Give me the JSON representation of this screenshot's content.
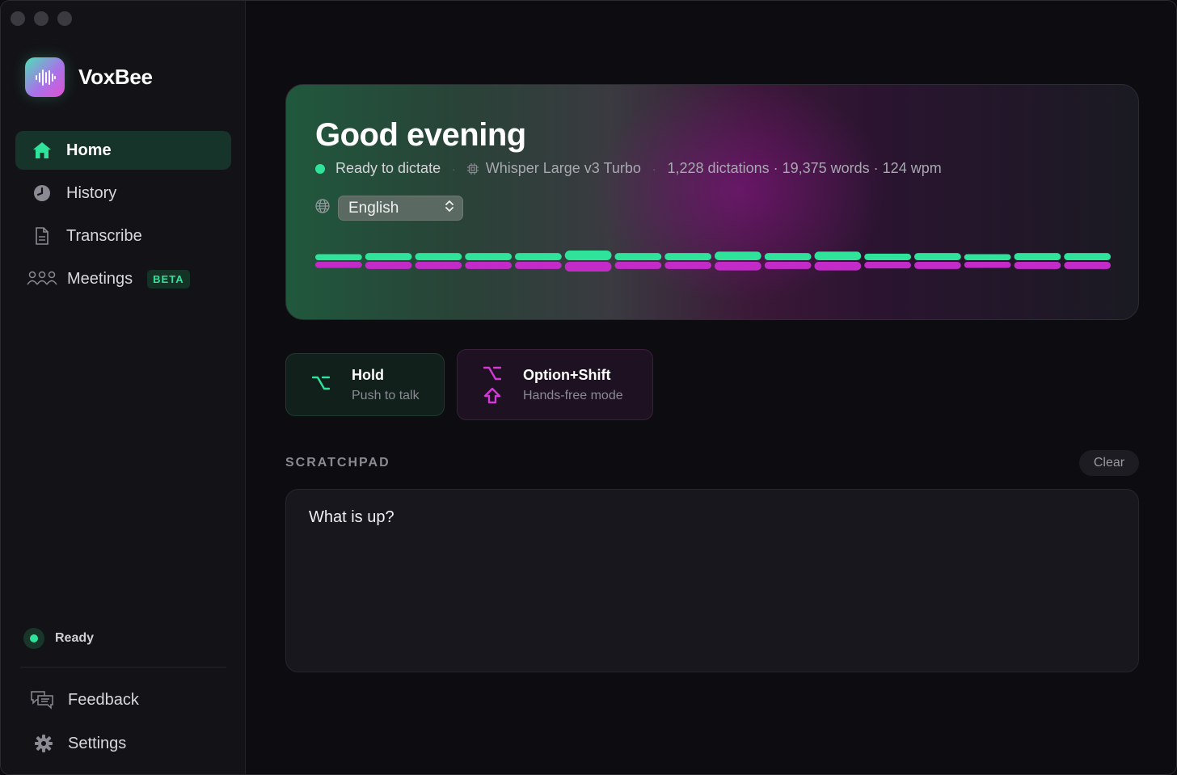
{
  "app": {
    "name": "VoxBee"
  },
  "sidebar": {
    "items": [
      {
        "label": "Home",
        "icon": "home-icon",
        "active": true
      },
      {
        "label": "History",
        "icon": "clock-icon",
        "active": false
      },
      {
        "label": "Transcribe",
        "icon": "document-icon",
        "active": false
      },
      {
        "label": "Meetings",
        "icon": "people-icon",
        "active": false,
        "badge": "BETA"
      }
    ],
    "status": "Ready",
    "footer": [
      {
        "label": "Feedback",
        "icon": "feedback-icon"
      },
      {
        "label": "Settings",
        "icon": "gear-icon"
      }
    ]
  },
  "hero": {
    "greeting": "Good evening",
    "status": "Ready to dictate",
    "model": "Whisper Large v3 Turbo",
    "stats": "1,228 dictations · 19,375 words · 124 wpm",
    "language": "English"
  },
  "shortcuts": [
    {
      "key_symbol": "⌥",
      "title": "Hold",
      "subtitle": "Push to talk"
    },
    {
      "key_symbol": "⌥⇧",
      "title": "Option+Shift",
      "subtitle": "Hands-free mode"
    }
  ],
  "scratchpad": {
    "label": "SCRATCHPAD",
    "clear_label": "Clear",
    "content": "What is up?"
  },
  "waveform": {
    "top": [
      0.35,
      0.55,
      0.55,
      0.55,
      0.55,
      1.0,
      0.55,
      0.55,
      0.8,
      0.55,
      0.8,
      0.45,
      0.55,
      0.35,
      0.55,
      0.55
    ],
    "bottom": [
      0.35,
      0.55,
      0.55,
      0.55,
      0.55,
      1.0,
      0.55,
      0.55,
      0.8,
      0.55,
      0.8,
      0.45,
      0.55,
      0.35,
      0.55,
      0.55
    ]
  },
  "colors": {
    "accent_green": "#2fe39b",
    "accent_magenta": "#c22bc8",
    "background": "#0d0d11",
    "sidebar": "#131317"
  }
}
